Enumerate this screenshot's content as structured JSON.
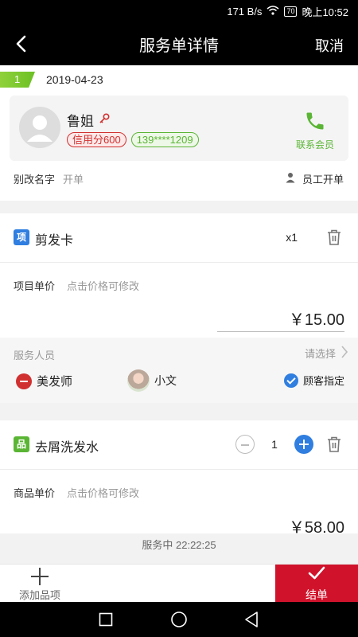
{
  "status_bar": {
    "speed": "171 B/s",
    "battery": "70",
    "time": "晚上10:52"
  },
  "nav": {
    "title": "服务单详情",
    "cancel": "取消"
  },
  "order": {
    "index": "1",
    "date": "2019-04-23"
  },
  "member": {
    "name": "鲁姐",
    "credit_badge": "信用分600",
    "phone_badge": "139****1209",
    "contact_label": "联系会员"
  },
  "alias": {
    "label": "别改名字",
    "value": "开单",
    "staff_open": "员工开单"
  },
  "item1": {
    "icon_text": "项",
    "name": "剪发卡",
    "qty": "x1",
    "price_label": "项目单价",
    "price_hint": "点击价格可修改",
    "price": "￥15.00",
    "staff_label": "服务人员",
    "staff_select": "请选择",
    "role": "美发师",
    "staffer": "小文",
    "designated": "顾客指定"
  },
  "item2": {
    "icon_text": "品",
    "name": "去屑洗发水",
    "qty": "1",
    "price_label": "商品单价",
    "price_hint": "点击价格可修改",
    "price": "￥58.00"
  },
  "timer": "服务中 22:22:25",
  "bottom": {
    "add_item": "添加品项",
    "checkout": "结单"
  },
  "colors": {
    "accent_red": "#d0132b",
    "green": "#5ab534",
    "blue": "#2f7ee0"
  }
}
